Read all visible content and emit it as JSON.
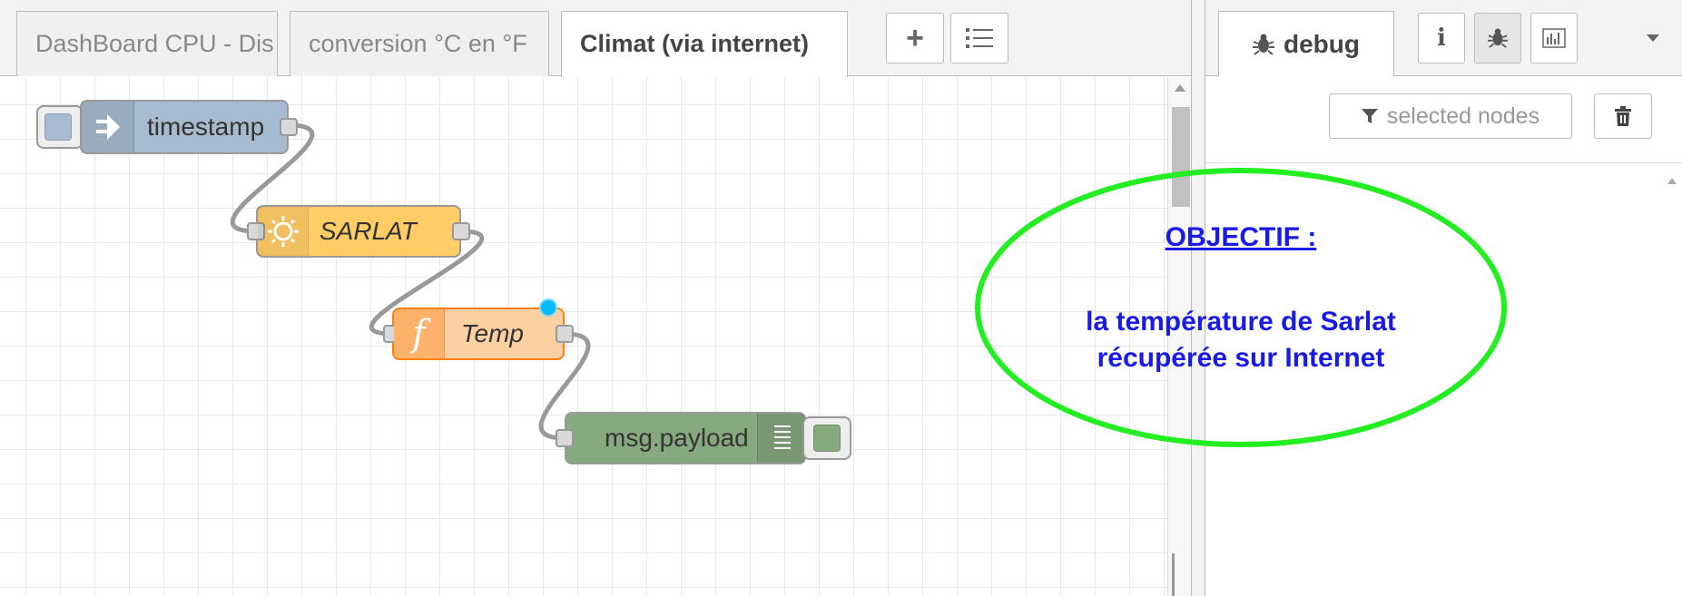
{
  "workspace_tabs": [
    {
      "label": "DashBoard CPU - Dis",
      "active": false
    },
    {
      "label": "conversion °C en °F",
      "active": false
    },
    {
      "label": "Climat (via internet)",
      "active": true
    }
  ],
  "tab_buttons": {
    "add": "+",
    "list": "≡"
  },
  "nodes": {
    "timestamp": {
      "label": "timestamp",
      "type": "inject",
      "color": "#a6bbcf"
    },
    "sarlat": {
      "label": "SARLAT",
      "type": "weather",
      "color": "#ffcc66"
    },
    "temp": {
      "label": "Temp",
      "type": "function",
      "color": "#fdd0a2"
    },
    "debug": {
      "label": "msg.payload",
      "type": "debug",
      "color": "#87a980"
    }
  },
  "sidebar": {
    "active_tab": "debug",
    "filter_label": "selected nodes",
    "buttons": [
      "info-icon",
      "bug-icon",
      "chart-icon",
      "chevron-down-icon"
    ]
  },
  "annotation": {
    "heading": "OBJECTIF :",
    "line1": "la température de Sarlat",
    "line2": "récupérée sur Internet",
    "ellipse_color": "#22ee22",
    "text_color": "#1a1ae6"
  }
}
